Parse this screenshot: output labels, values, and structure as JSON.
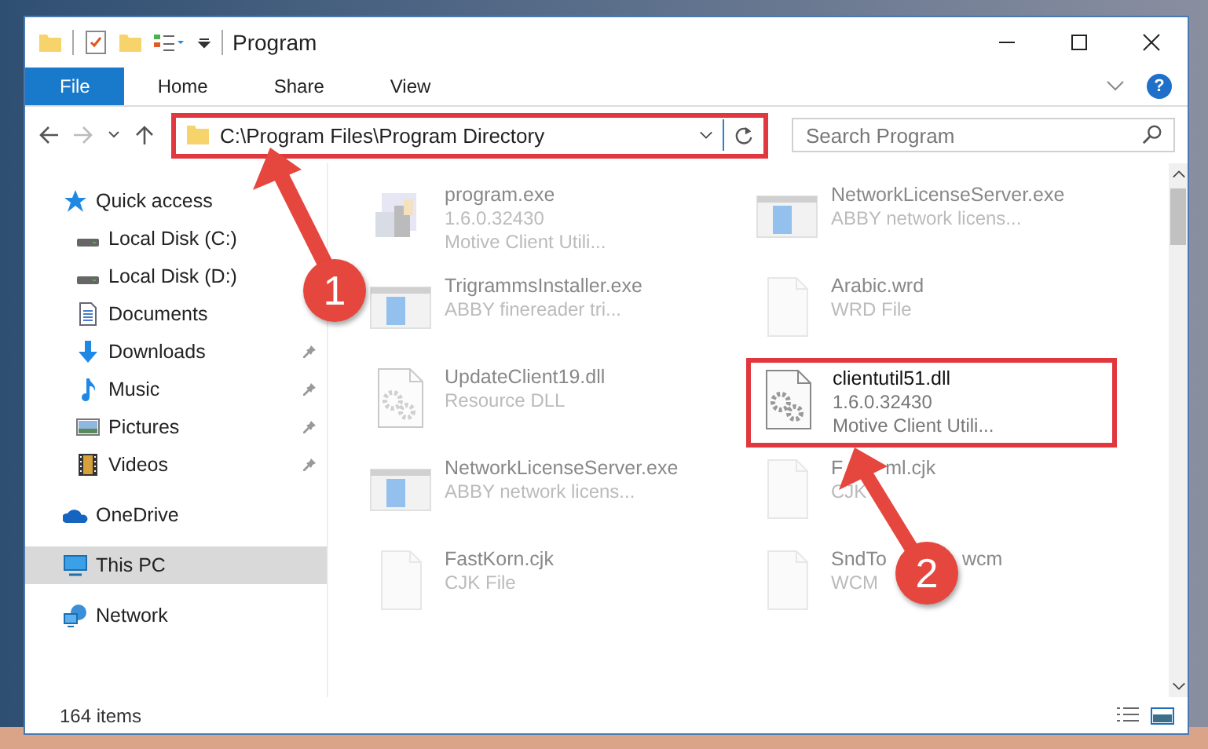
{
  "window": {
    "title": "Program"
  },
  "ribbon_tabs": [
    {
      "label": "File",
      "selected": true
    },
    {
      "label": "Home",
      "selected": false
    },
    {
      "label": "Share",
      "selected": false
    },
    {
      "label": "View",
      "selected": false
    }
  ],
  "help_button": "?",
  "address_bar": {
    "path": "C:\\Program Files\\Program Directory",
    "highlighted": true
  },
  "search": {
    "placeholder": "Search Program"
  },
  "sidebar": {
    "items": [
      {
        "label": "Quick access",
        "kind": "star",
        "selected": false,
        "children": [
          {
            "label": "Local Disk (C:)",
            "kind": "disk",
            "selected": false
          },
          {
            "label": "Local Disk (D:)",
            "kind": "disk",
            "selected": false
          },
          {
            "label": "Documents",
            "kind": "documents",
            "selected": false
          },
          {
            "label": "Downloads",
            "kind": "downloads",
            "pinned": true,
            "selected": false
          },
          {
            "label": "Music",
            "kind": "music",
            "pinned": true,
            "selected": false
          },
          {
            "label": "Pictures",
            "kind": "pictures",
            "pinned": true,
            "selected": false
          },
          {
            "label": "Videos",
            "kind": "videos",
            "pinned": true,
            "selected": false
          }
        ]
      },
      {
        "label": "OneDrive",
        "kind": "cloud",
        "selected": false
      },
      {
        "label": "This PC",
        "kind": "pc",
        "selected": true
      },
      {
        "label": "Network",
        "kind": "network",
        "selected": false
      }
    ]
  },
  "files": [
    {
      "name_parts": [
        "program.exe"
      ],
      "details": [
        "1.6.0.32430",
        "Motive Client Utili..."
      ],
      "kind": "setup",
      "dimmed": true
    },
    {
      "name_parts": [
        "NetworkLicenseServer.exe"
      ],
      "details": [
        "ABBY network licens..."
      ],
      "kind": "app",
      "dimmed": true
    },
    {
      "name_parts": [
        "TrigrammsInstaller.exe"
      ],
      "details": [
        "ABBY finereader tri..."
      ],
      "kind": "app",
      "dimmed": true
    },
    {
      "name_parts": [
        "Arabic.wrd"
      ],
      "details": [
        "WRD File"
      ],
      "kind": "doc",
      "dimmed": true
    },
    {
      "name_parts": [
        "UpdateClient19.dll"
      ],
      "details": [
        "Resource DLL"
      ],
      "kind": "dll",
      "dimmed": true
    },
    {
      "name_parts": [
        "clientutil51.dll"
      ],
      "details": [
        "1.6.0.32430",
        "Motive Client Utili..."
      ],
      "kind": "dll",
      "dimmed": false,
      "highlighted": true
    },
    {
      "name_parts": [
        "NetworkLicenseServer.exe"
      ],
      "details": [
        "ABBY network licens..."
      ],
      "kind": "app",
      "dimmed": true
    },
    {
      "name_parts": [
        "F",
        "ml.cjk"
      ],
      "details": [
        "CJK"
      ],
      "kind": "doc",
      "dimmed": true
    },
    {
      "name_parts": [
        "FastKorn.cjk"
      ],
      "details": [
        "CJK File"
      ],
      "kind": "doc",
      "dimmed": true
    },
    {
      "name_parts": [
        "SndTo",
        "wcm"
      ],
      "details": [
        "WCM"
      ],
      "kind": "doc",
      "dimmed": true
    }
  ],
  "status_bar": {
    "item_count": "164 items"
  },
  "callouts": [
    "1",
    "2"
  ]
}
